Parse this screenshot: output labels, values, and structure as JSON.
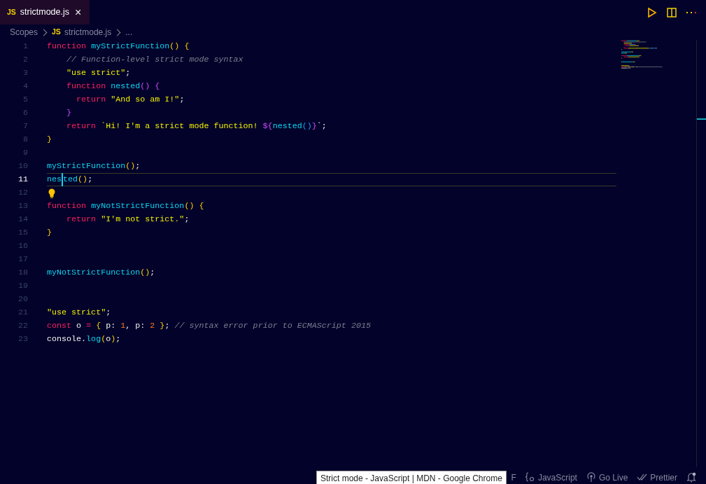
{
  "tab": {
    "label": "strictmode.js",
    "badge": "JS",
    "close": "×",
    "selected": true
  },
  "breadcrumb": [
    {
      "text": "Scopes",
      "kind": "folder"
    },
    {
      "text": "strictmode.js",
      "kind": "file",
      "badge": "JS"
    },
    {
      "text": "...",
      "kind": "more"
    }
  ],
  "lines": [
    {
      "number": "1",
      "current": false,
      "tokens": [
        {
          "kind": "kw",
          "text": "function "
        },
        {
          "kind": "fn",
          "text": "myStrictFunction"
        },
        {
          "kind": "pn",
          "text": "() {"
        }
      ]
    },
    {
      "number": "2",
      "current": false,
      "tokens": [
        {
          "kind": "cm",
          "text": "    // Function-level strict mode syntax"
        }
      ]
    },
    {
      "number": "3",
      "current": false,
      "tokens": [
        {
          "kind": "str",
          "text": "    \"use strict\""
        },
        {
          "kind": "plain",
          "text": ";"
        }
      ]
    },
    {
      "number": "4",
      "current": false,
      "tokens": [
        {
          "kind": "kw",
          "text": "    function "
        },
        {
          "kind": "fn",
          "text": "nested"
        },
        {
          "kind": "pn2",
          "text": "() {"
        }
      ]
    },
    {
      "number": "5",
      "current": false,
      "tokens": [
        {
          "kind": "kw",
          "text": "      return "
        },
        {
          "kind": "str",
          "text": "\"And so am I!\""
        },
        {
          "kind": "plain",
          "text": ";"
        }
      ]
    },
    {
      "number": "6",
      "current": false,
      "tokens": [
        {
          "kind": "pn2",
          "text": "    }"
        }
      ]
    },
    {
      "number": "7",
      "current": false,
      "tokens": [
        {
          "kind": "kw",
          "text": "    return "
        },
        {
          "kind": "str",
          "text": "`Hi! I'm a strict mode function! "
        },
        {
          "kind": "pn2",
          "text": "${"
        },
        {
          "kind": "fn",
          "text": "nested"
        },
        {
          "kind": "pn3",
          "text": "()"
        },
        {
          "kind": "pn2",
          "text": "}"
        },
        {
          "kind": "plain",
          "text": "`;"
        }
      ]
    },
    {
      "number": "8",
      "current": false,
      "tokens": [
        {
          "kind": "pn",
          "text": "}"
        }
      ]
    },
    {
      "number": "9",
      "current": false
    },
    {
      "number": "10",
      "current": false,
      "tokens": [
        {
          "kind": "fn",
          "text": "myStrictFunction"
        },
        {
          "kind": "pn",
          "text": "()"
        },
        {
          "kind": "plain",
          "text": ";"
        }
      ]
    },
    {
      "number": "11",
      "current": true,
      "tokens": [
        {
          "kind": "fn",
          "text": "nes"
        },
        {
          "kind": "fn",
          "text": "ted",
          "cursor": true
        },
        {
          "kind": "pn",
          "text": "()"
        },
        {
          "kind": "plain",
          "text": ";"
        }
      ]
    },
    {
      "number": "12",
      "current": false,
      "lightbulb": true
    },
    {
      "number": "13",
      "current": false,
      "tokens": [
        {
          "kind": "kw",
          "text": "function "
        },
        {
          "kind": "fn",
          "text": "myNotStrictFunction"
        },
        {
          "kind": "pn",
          "text": "() {"
        }
      ]
    },
    {
      "number": "14",
      "current": false,
      "tokens": [
        {
          "kind": "kw",
          "text": "    return "
        },
        {
          "kind": "str",
          "text": "\"I'm not strict.\""
        },
        {
          "kind": "plain",
          "text": ";"
        }
      ]
    },
    {
      "number": "15",
      "current": false,
      "tokens": [
        {
          "kind": "pn",
          "text": "}"
        }
      ]
    },
    {
      "number": "16",
      "current": false
    },
    {
      "number": "17",
      "current": false
    },
    {
      "number": "18",
      "current": false,
      "tokens": [
        {
          "kind": "fn",
          "text": "myNotStrictFunction"
        },
        {
          "kind": "pn",
          "text": "()"
        },
        {
          "kind": "plain",
          "text": ";"
        }
      ]
    },
    {
      "number": "19",
      "current": false
    },
    {
      "number": "20",
      "current": false
    },
    {
      "number": "21",
      "current": false,
      "tokens": [
        {
          "kind": "str",
          "text": "\"use strict\""
        },
        {
          "kind": "plain",
          "text": ";"
        }
      ]
    },
    {
      "number": "22",
      "current": false,
      "tokens": [
        {
          "kind": "kw",
          "text": "const "
        },
        {
          "kind": "plain",
          "text": "o "
        },
        {
          "kind": "kw",
          "text": "= "
        },
        {
          "kind": "pn",
          "text": "{ "
        },
        {
          "kind": "plain",
          "text": "p: "
        },
        {
          "kind": "num",
          "text": "1"
        },
        {
          "kind": "plain",
          "text": ", p: "
        },
        {
          "kind": "num",
          "text": "2"
        },
        {
          "kind": "pn",
          "text": " }"
        },
        {
          "kind": "plain",
          "text": "; "
        },
        {
          "kind": "cm",
          "text": "// syntax error prior to ECMAScript 2015"
        }
      ]
    },
    {
      "number": "23",
      "current": false,
      "tokens": [
        {
          "kind": "plain",
          "text": "console."
        },
        {
          "kind": "fn",
          "text": "log"
        },
        {
          "kind": "pn",
          "text": "("
        },
        {
          "kind": "plain",
          "text": "o"
        },
        {
          "kind": "pn",
          "text": ")"
        },
        {
          "kind": "plain",
          "text": ";"
        }
      ]
    }
  ],
  "status_bar": [
    {
      "kind": "text",
      "text": "F"
    },
    {
      "kind": "language",
      "text": "JavaScript"
    },
    {
      "kind": "live",
      "text": "Go Live"
    },
    {
      "kind": "prettier",
      "text": "Prettier"
    },
    {
      "kind": "bell"
    }
  ],
  "tooltip": "Strict mode - JavaScript | MDN - Google Chrome"
}
